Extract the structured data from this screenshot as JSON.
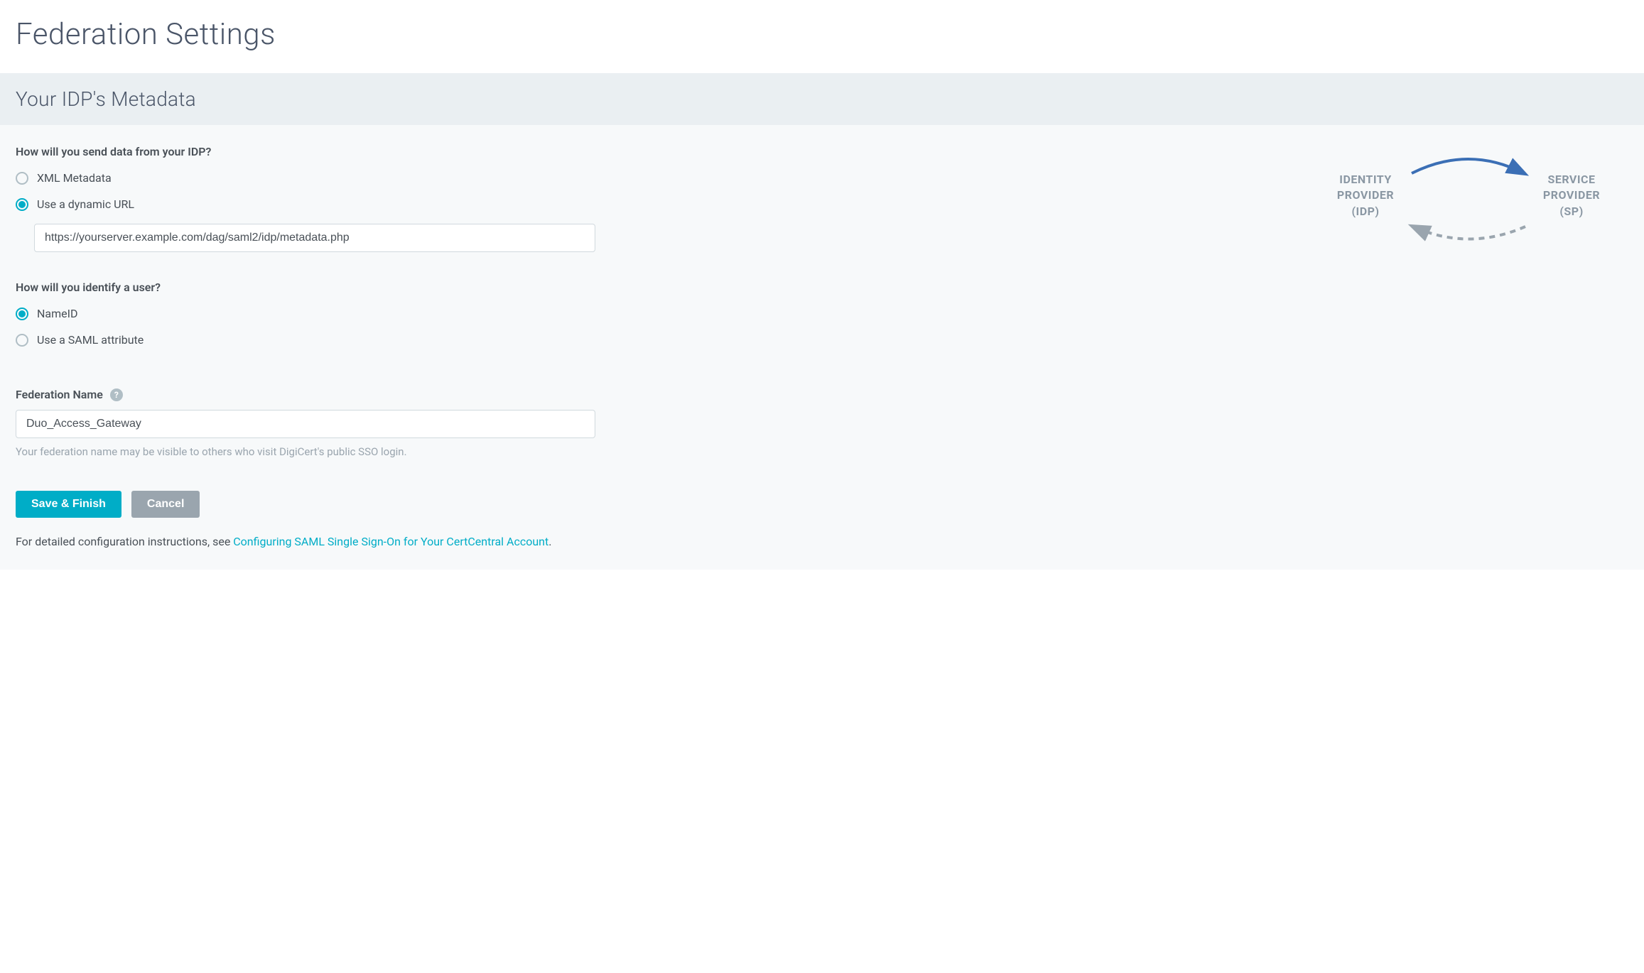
{
  "page": {
    "title": "Federation Settings",
    "subheader": "Your IDP's Metadata"
  },
  "sendData": {
    "question": "How will you send data from your IDP?",
    "options": {
      "xml": {
        "label": "XML Metadata",
        "selected": false
      },
      "url": {
        "label": "Use a dynamic URL",
        "selected": true
      }
    },
    "urlValue": "https://yourserver.example.com/dag/saml2/idp/metadata.php"
  },
  "identifyUser": {
    "question": "How will you identify a user?",
    "options": {
      "nameid": {
        "label": "NameID",
        "selected": true
      },
      "saml": {
        "label": "Use a SAML attribute",
        "selected": false
      }
    }
  },
  "federationName": {
    "label": "Federation Name",
    "value": "Duo_Access_Gateway",
    "helper": "Your federation name may be visible to others who visit DigiCert's public SSO login."
  },
  "buttons": {
    "save": "Save & Finish",
    "cancel": "Cancel"
  },
  "helpLine": {
    "prefix": "For detailed configuration instructions, see ",
    "linkText": "Configuring SAML Single Sign-On for Your CertCentral Account",
    "suffix": "."
  },
  "diagram": {
    "left": {
      "line1": "IDENTITY",
      "line2": "PROVIDER",
      "line3": "(IDP)"
    },
    "right": {
      "line1": "SERVICE",
      "line2": "PROVIDER",
      "line3": "(SP)"
    }
  }
}
